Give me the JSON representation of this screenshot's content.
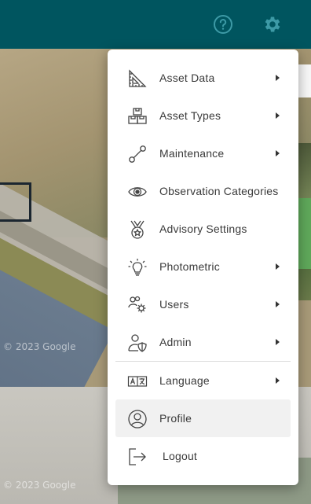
{
  "header": {
    "help_icon": "help-circle-icon",
    "settings_icon": "gear-icon",
    "background_color": "#00555f"
  },
  "map": {
    "watermark_1": "© 2023 Google",
    "watermark_2": "© 2023 Google"
  },
  "menu": {
    "items": [
      {
        "label": "Asset Data",
        "icon": "ruler-triangle-icon",
        "has_submenu": true
      },
      {
        "label": "Asset Types",
        "icon": "stacked-boxes-icon",
        "has_submenu": true
      },
      {
        "label": "Maintenance",
        "icon": "wrench-icon",
        "has_submenu": true
      },
      {
        "label": "Observation Categories",
        "icon": "eye-icon",
        "has_submenu": false
      },
      {
        "label": "Advisory Settings",
        "icon": "medal-icon",
        "has_submenu": false
      },
      {
        "label": "Photometric",
        "icon": "lightbulb-icon",
        "has_submenu": true
      },
      {
        "label": "Users",
        "icon": "users-gear-icon",
        "has_submenu": true
      },
      {
        "label": "Admin",
        "icon": "user-shield-icon",
        "has_submenu": true
      },
      {
        "label": "Language",
        "icon": "translate-icon",
        "has_submenu": true
      },
      {
        "label": "Profile",
        "icon": "user-circle-icon",
        "has_submenu": false,
        "highlighted": true
      },
      {
        "label": "Logout",
        "icon": "logout-icon",
        "has_submenu": false
      }
    ]
  }
}
